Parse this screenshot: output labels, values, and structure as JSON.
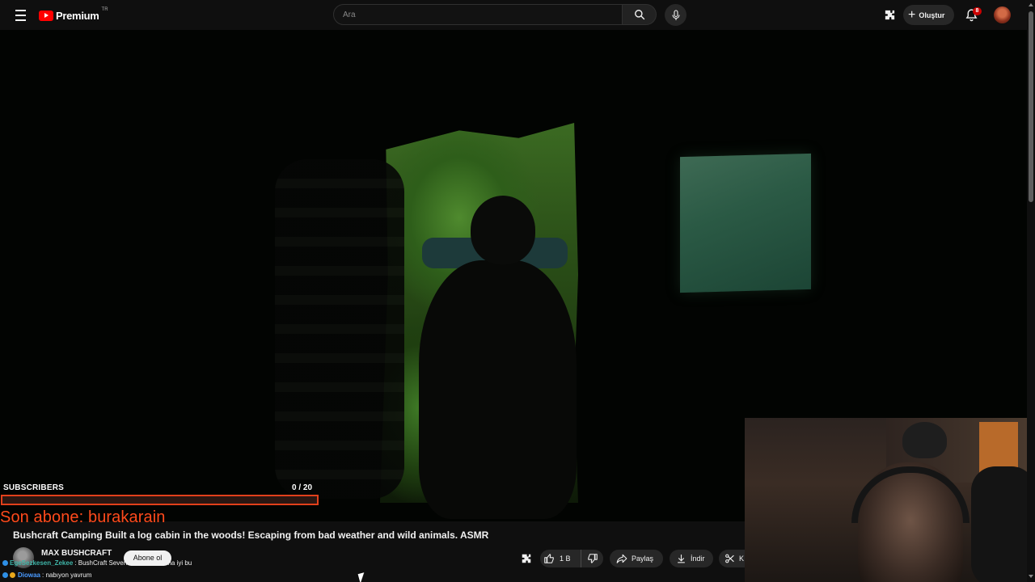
{
  "header": {
    "logo_text": "Premium",
    "logo_region": "TR",
    "search_placeholder": "Ara",
    "create_label": "Oluştur",
    "notification_count": "8"
  },
  "video": {
    "title": "Bushcraft Camping Built a log cabin in the woods! Escaping from bad weather and wild animals. ASMR",
    "channel_name": "MAX BUSHCRAFT",
    "subscribe_label": "Abone ol",
    "like_count": "1 B",
    "share_label": "Paylaş",
    "download_label": "İndir",
    "clip_label": "K"
  },
  "overlay": {
    "subscribers_label": "SUBSCRIBERS",
    "subscribers_progress": "0  / 20",
    "subscribers_fraction": 0.0,
    "last_subscriber": "Son abone: burakarain"
  },
  "chat": [
    {
      "user": "EgeSezkesen_Zekee",
      "message": ": BushCraft Sevenler avuktan daha iyi bu"
    },
    {
      "user": "Diowaa",
      "message": ": nabıyon yavrum"
    }
  ],
  "colors": {
    "accent": "#ff0000",
    "overlay_orange": "#ff4a1c",
    "background": "#0f0f0f",
    "button_bg": "#272727"
  }
}
